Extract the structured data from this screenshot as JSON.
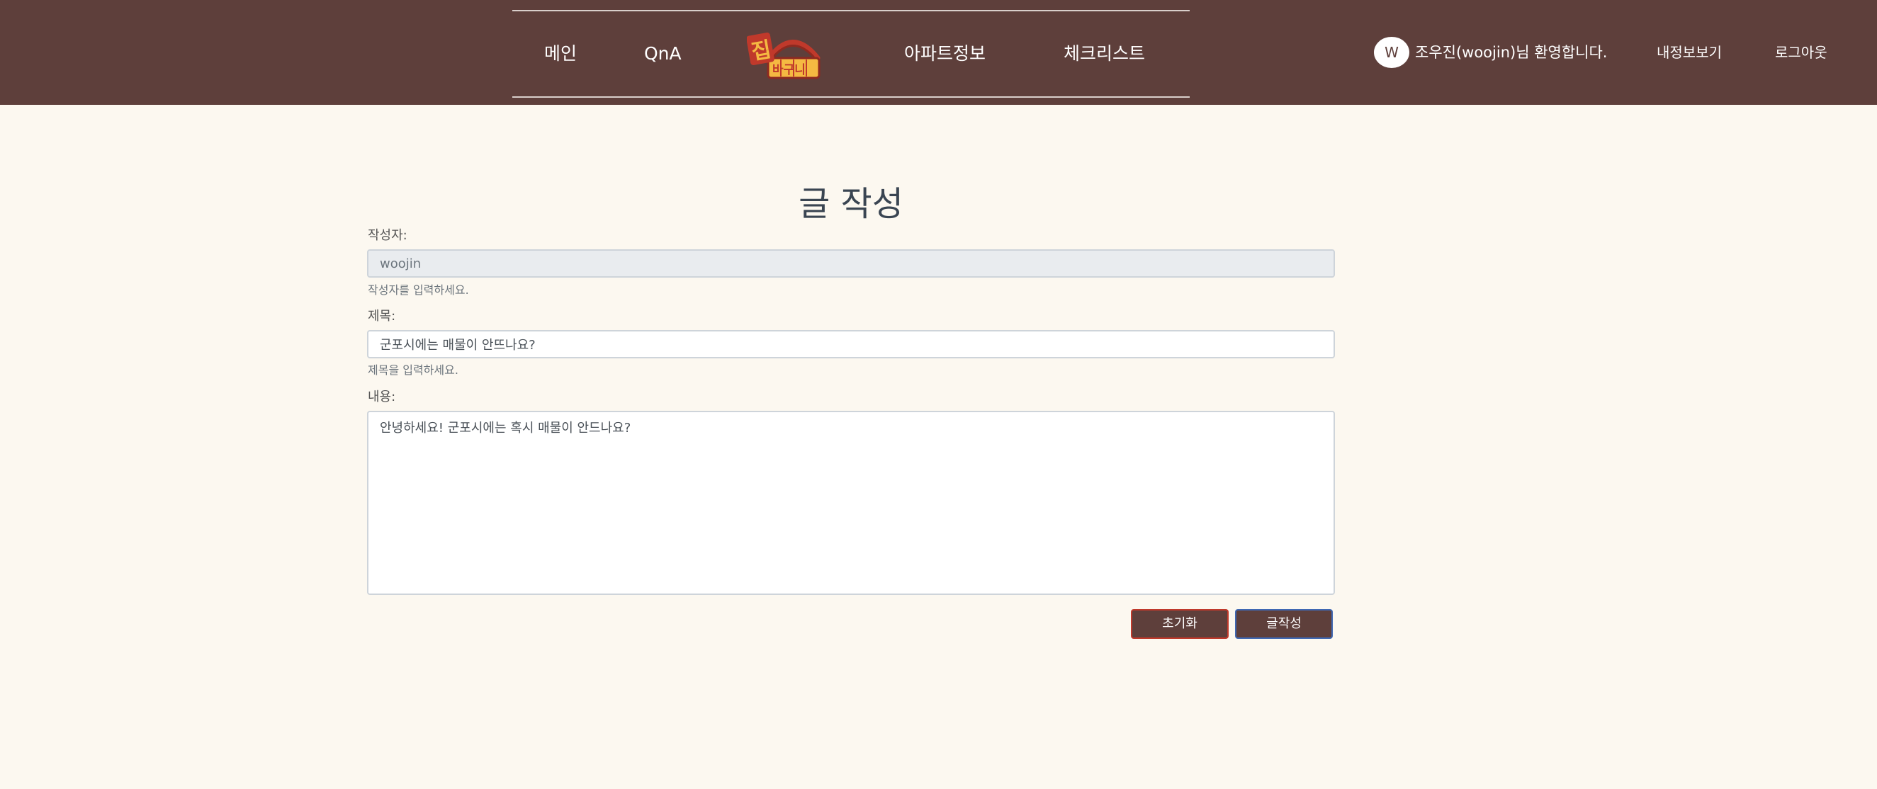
{
  "header": {
    "nav": {
      "main": "메인",
      "qna": "QnA",
      "apartment_info": "아파트정보",
      "checklist": "체크리스트"
    },
    "logo": {
      "line1": "집",
      "line2": "바구니"
    },
    "user": {
      "avatar_letter": "W",
      "welcome": "조우진(woojin)님 환영합니다.",
      "profile_link": "내정보보기",
      "logout_link": "로그아웃"
    }
  },
  "form": {
    "title": "글 작성",
    "author": {
      "label": "작성자:",
      "value": "woojin",
      "hint": "작성자를 입력하세요."
    },
    "subject": {
      "label": "제목:",
      "value": "군포시에는 매물이 안뜨나요?",
      "hint": "제목을 입력하세요."
    },
    "content": {
      "label": "내용:",
      "value": "안녕하세요! 군포시에는 혹시 매물이 안드나요?"
    },
    "buttons": {
      "reset": "초기화",
      "submit": "글작성"
    }
  },
  "colors": {
    "header_bg": "#5e3f3b",
    "page_bg": "#fcf8f0",
    "button_bg": "#5e3f3b",
    "logo_red": "#c0392b",
    "logo_yellow": "#f5b942"
  }
}
